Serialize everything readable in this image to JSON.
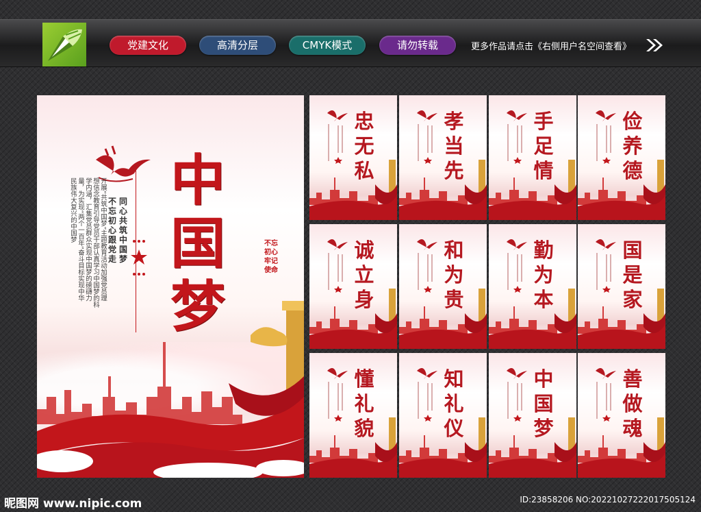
{
  "header": {
    "tags": [
      {
        "label": "党建文化",
        "color": "#c01a2c"
      },
      {
        "label": "高清分层",
        "color": "#2e4d78"
      },
      {
        "label": "CMYK模式",
        "color": "#1a6e6a"
      },
      {
        "label": "请勿转载",
        "color": "#6a2a8c"
      }
    ],
    "notice": "更多作品请点击《右侧用户名空间查看》",
    "logo_icon": "pen-tool-icon",
    "arrow_icon": "double-chevron-right-icon"
  },
  "main_poster": {
    "title": "中国梦",
    "logo_text": "中国梦",
    "slogan_1": "不忘初心跟党走",
    "slogan_2": "同心共筑中国梦",
    "body": "开展“共筑中国梦”主题教育活动加强党员理想信念教育引导党员干部认真学习中国梦的科学内涵，汇集党员群众实现中国梦的磅礴力量，为实现“两个一百年”奋斗目标实现中华民族伟大复兴的中国梦",
    "seal": "不忘初心 牢记使命",
    "accent_color": "#c2161b"
  },
  "mini_posters": [
    {
      "title": "忠无私"
    },
    {
      "title": "孝当先"
    },
    {
      "title": "手足情"
    },
    {
      "title": "俭养德"
    },
    {
      "title": "诚立身"
    },
    {
      "title": "和为贵"
    },
    {
      "title": "勤为本"
    },
    {
      "title": "国是家"
    },
    {
      "title": "懂礼貌"
    },
    {
      "title": "知礼仪"
    },
    {
      "title": "中国梦"
    },
    {
      "title": "善做魂"
    }
  ],
  "footer": {
    "site": "昵图网 www.nipic.com",
    "id_text": "ID:23858206 NO:20221027222017505124"
  }
}
